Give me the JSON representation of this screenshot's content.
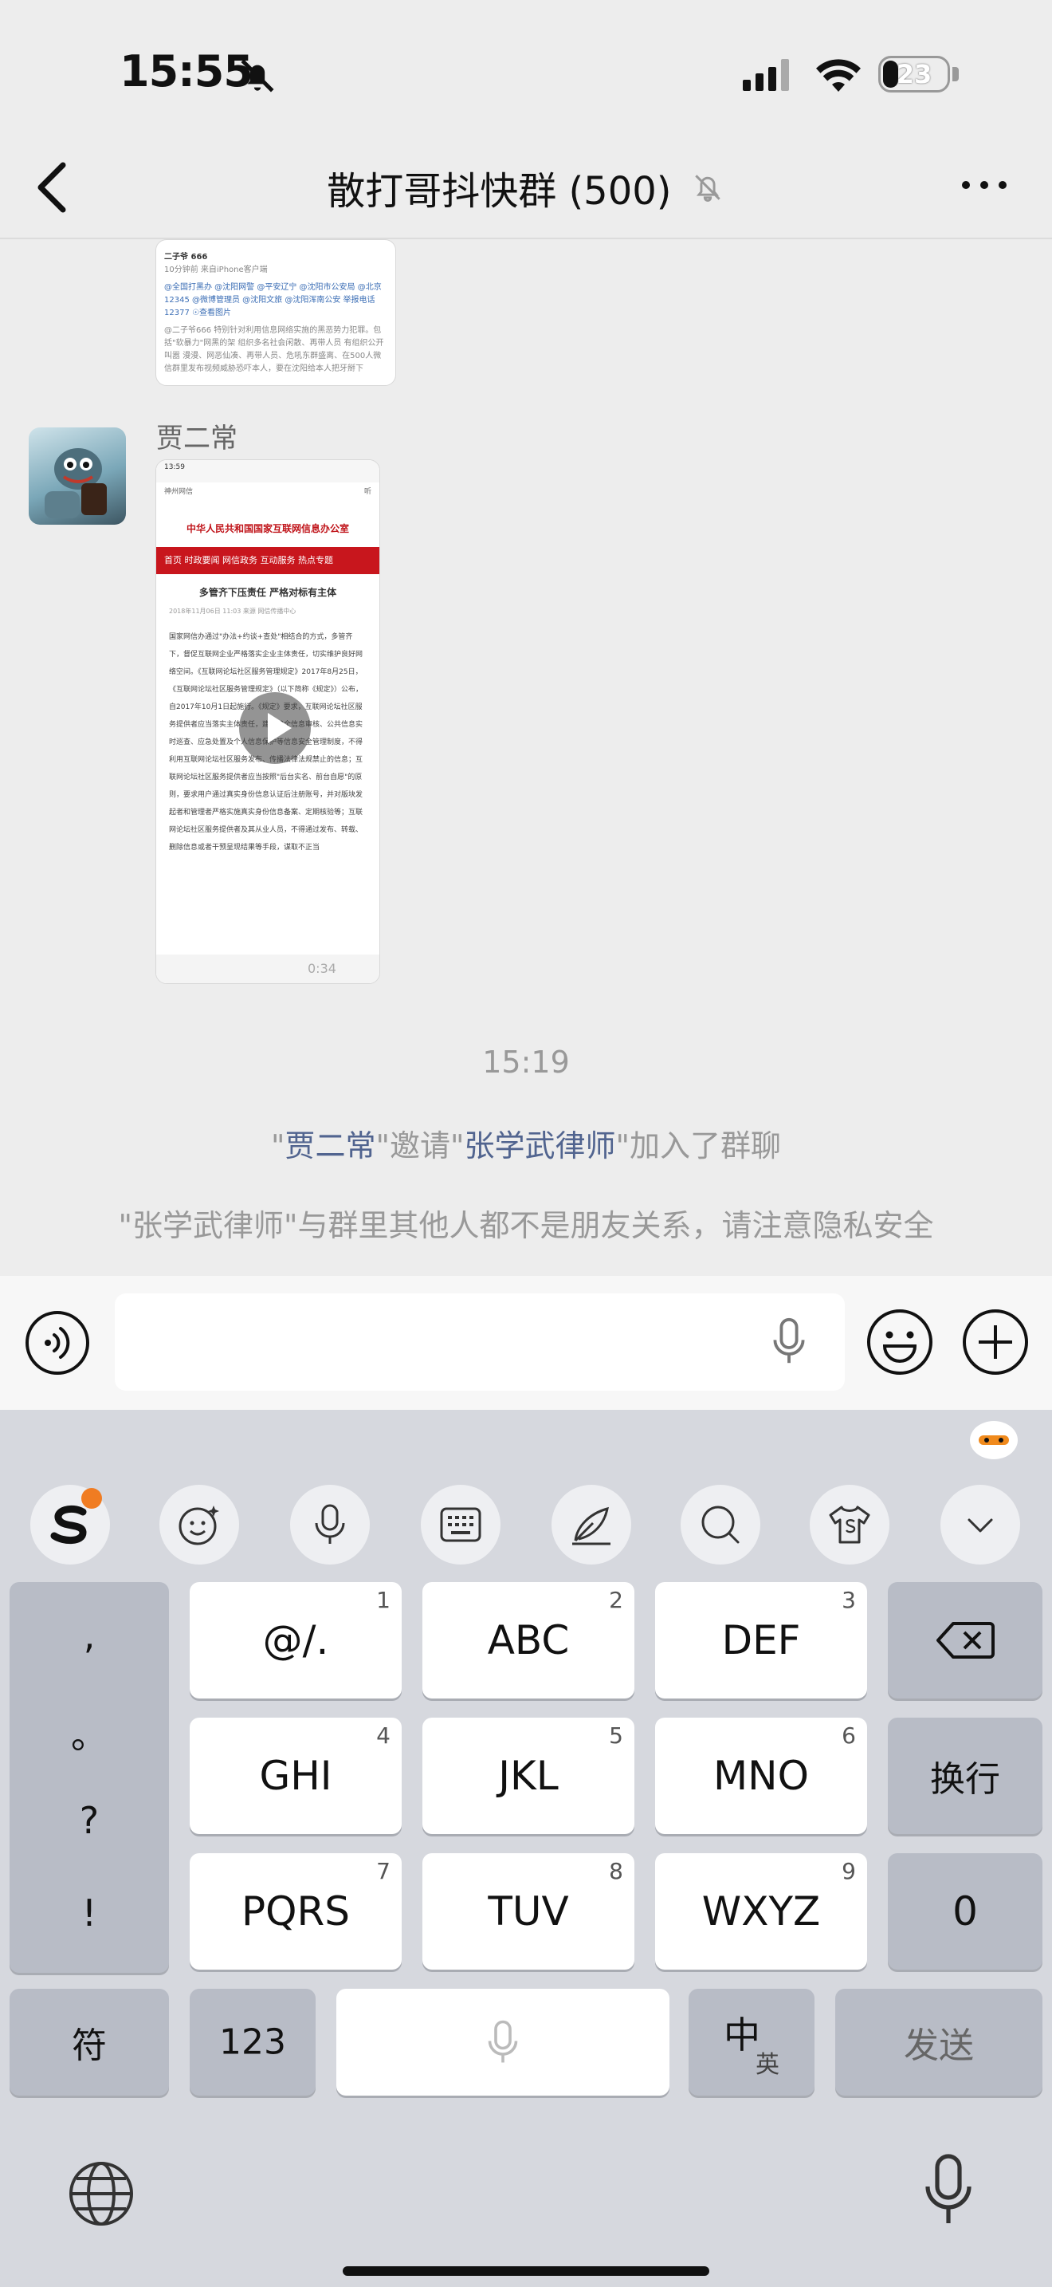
{
  "status": {
    "time": "15:55",
    "battery": "23",
    "battery_level": 0.23
  },
  "nav": {
    "title": "散打哥抖快群 (500)"
  },
  "messages": {
    "shot1": {
      "account": "二子爷 666",
      "source": "10分钟前 来自iPhone客户端",
      "mentions": "@全国打黑办 @沈阳网警 @平安辽宁 @沈阳市公安局 @北京12345 @微博管理员 @沈阳文旅 @沈阳浑南公安 举报电话12377 ☉查看图片",
      "excerpt": "@二子爷666 特别针对利用信息网络实施的黑恶势力犯罪。包括\"软暴力\"网黑的架 组织多名社会闲散、再带人员 有组织公开叫嚣 漫漫、网恶仙凑、再带人员、危吼东群盛离、在500人微信群里发布视频威胁恐吓本人，要在沈阳给本人把牙掰下"
    },
    "sender": "贾二常",
    "shot2": {
      "statusbar": "13:59",
      "search": "神州网信",
      "listen": "听",
      "site_title": "中华人民共和国国家互联网信息办公室",
      "menu": "首页  时政要闻  网信政务  互动服务  热点专题",
      "headline": "多管齐下压责任 严格对标有主体",
      "meta": "2018年11月06日 11:03        来源 网信传播中心",
      "body": "国家网信办通过\"办法+约谈+查处\"相结合的方式，多管齐下，督促互联网企业严格落实企业主体责任，切实维护良好网络空间。《互联网论坛社区服务管理规定》2017年8月25日，《互联网论坛社区服务管理规定》（以下简称《规定》）公布，自2017年10月1日起施行。《规定》要求，互联网论坛社区服务提供者应当落实主体责任，建立健全信息审核、公共信息实时巡查、应急处置及个人信息保护等信息安全管理制度，不得利用互联网论坛社区服务发布、传播法律法规禁止的信息；互联网论坛社区服务提供者应当按照\"后台实名、前台自愿\"的原则，要求用户通过真实身份信息认证后注册账号，并对版块发起者和管理者严格实施真实身份信息备案、定期核验等；互联网论坛社区服务提供者及其从业人员，不得通过发布、转载、删除信息或者干预呈现结果等手段，谋取不正当",
      "play_label": "0:34"
    },
    "time_separator": "15:19",
    "system_invite": {
      "q1": "\"",
      "inviter": "贾二常",
      "q2": "\"邀请\"",
      "invitee": "张学武律师",
      "q3": "\"加入了群聊"
    },
    "system_privacy": "\"张学武律师\"与群里其他人都不是朋友关系，请注意隐私安全"
  },
  "input": {
    "value": ""
  },
  "keyboard": {
    "punctuation": [
      ",",
      "。",
      "?",
      "!"
    ],
    "rows": [
      [
        {
          "label": "@/.",
          "num": "1"
        },
        {
          "label": "ABC",
          "num": "2"
        },
        {
          "label": "DEF",
          "num": "3"
        }
      ],
      [
        {
          "label": "GHI",
          "num": "4"
        },
        {
          "label": "JKL",
          "num": "5"
        },
        {
          "label": "MNO",
          "num": "6"
        }
      ],
      [
        {
          "label": "PQRS",
          "num": "7"
        },
        {
          "label": "TUV",
          "num": "8"
        },
        {
          "label": "WXYZ",
          "num": "9"
        }
      ]
    ],
    "enter_label": "换行",
    "zero_label": "0",
    "symbol_label": "符",
    "num_label": "123",
    "lang_main": "中",
    "lang_sub": "英",
    "send_label": "发送"
  },
  "icons": {
    "status": [
      "bell-muted-icon",
      "signal-icon",
      "wifi-icon",
      "battery-icon"
    ],
    "nav": [
      "back-icon",
      "bell-muted-icon",
      "more-icon"
    ],
    "input_bar": [
      "voice-toggle-icon",
      "microphone-icon",
      "emoji-icon",
      "plus-icon"
    ],
    "keyboard_toolbar": [
      "sogou-logo-icon",
      "smart-emoji-icon",
      "microphone-icon",
      "keyboard-icon",
      "handwriting-pen-icon",
      "search-icon",
      "tshirt-skin-icon",
      "chevron-down-icon",
      "mascot-icon"
    ],
    "keyboard_bottom": [
      "backspace-icon",
      "globe-icon",
      "microphone-icon"
    ]
  }
}
